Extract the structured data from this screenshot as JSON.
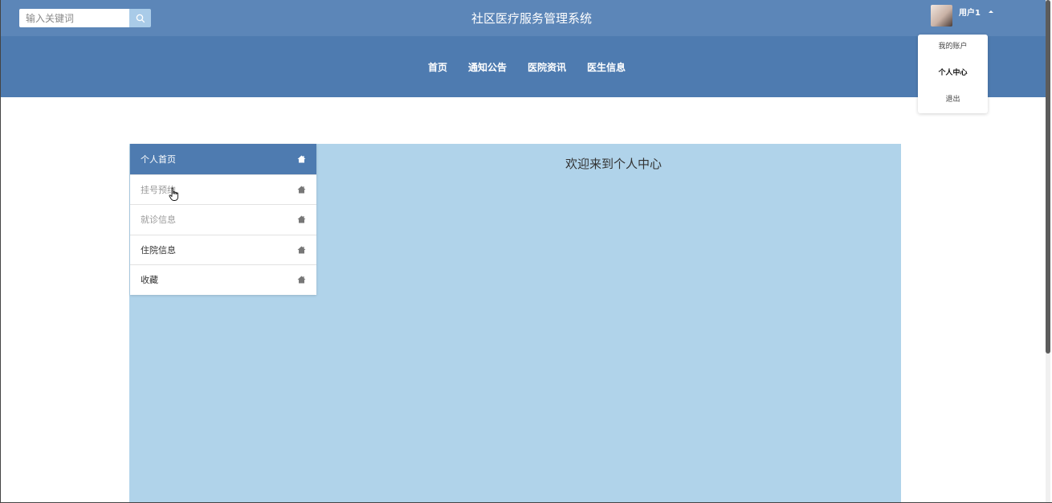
{
  "header": {
    "search": {
      "placeholder": "输入关键词",
      "icon": "search-icon"
    },
    "title": "社区医疗服务管理系统",
    "user": {
      "name": "用户1",
      "avatar_icon": "avatar-image"
    }
  },
  "nav": {
    "items": [
      {
        "label": "首页"
      },
      {
        "label": "通知公告"
      },
      {
        "label": "医院资讯"
      },
      {
        "label": "医生信息"
      }
    ]
  },
  "user_dropdown": {
    "items": [
      {
        "label": "我的账户"
      },
      {
        "label": "个人中心",
        "active": true
      },
      {
        "label": "退出"
      }
    ]
  },
  "sidebar": {
    "items": [
      {
        "label": "个人首页",
        "icon": "home-icon",
        "active": true
      },
      {
        "label": "挂号预约",
        "icon": "home-icon"
      },
      {
        "label": "就诊信息",
        "icon": "home-icon"
      },
      {
        "label": "住院信息",
        "icon": "home-icon"
      },
      {
        "label": "收藏",
        "icon": "home-icon"
      }
    ]
  },
  "main": {
    "welcome": "欢迎来到个人中心"
  },
  "colors": {
    "top_bar": "#5c86b8",
    "nav_bar": "#4e7bb0",
    "content_bg": "#b0d3ea",
    "search_button": "#a9cbe8"
  }
}
